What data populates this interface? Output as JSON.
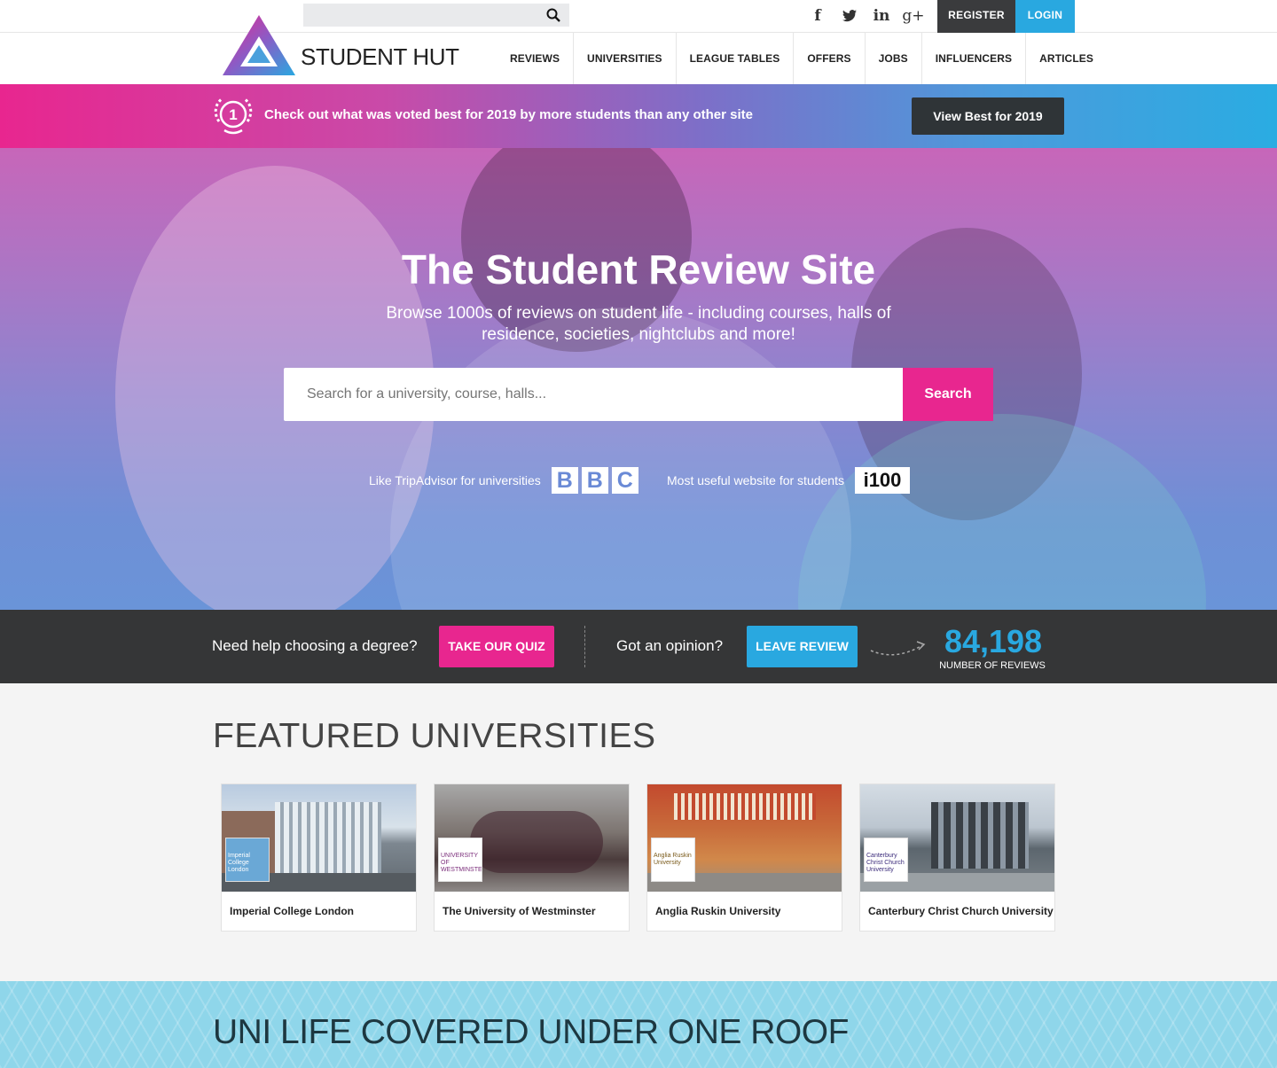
{
  "topbar": {
    "search_placeholder": "",
    "social": [
      {
        "icon": "facebook-icon",
        "glyph": "f"
      },
      {
        "icon": "twitter-icon",
        "glyph": "ᵯ"
      },
      {
        "icon": "linkedin-icon",
        "glyph": "in"
      },
      {
        "icon": "google-plus-icon",
        "glyph": "g+"
      }
    ],
    "register_label": "REGISTER",
    "login_label": "LOGIN"
  },
  "header": {
    "brand": "STUDENT HUT",
    "nav": [
      "REVIEWS",
      "UNIVERSITIES",
      "LEAGUE TABLES",
      "OFFERS",
      "JOBS",
      "INFLUENCERS",
      "ARTICLES"
    ]
  },
  "promo": {
    "badge_number": "1",
    "text": "Check out what was voted best for 2019 by more students than any other site",
    "button_label": "View Best for 2019"
  },
  "hero": {
    "title": "The Student Review Site",
    "subtitle": "Browse 1000s of reviews on student life - including courses, halls of residence, societies, nightclubs and more!",
    "search_placeholder": "Search for a university, course, halls...",
    "search_button": "Search",
    "press": [
      {
        "text": "Like TripAdvisor for universities",
        "logo": "BBC"
      },
      {
        "text": "Most useful website for students",
        "logo": "i100"
      }
    ]
  },
  "strip": {
    "degree_question": "Need help choosing a degree?",
    "quiz_label": "TAKE OUR QUIZ",
    "opinion_question": "Got an opinion?",
    "review_label": "LEAVE REVIEW",
    "review_count": "84,198",
    "review_count_label": "NUMBER OF REVIEWS"
  },
  "featured": {
    "heading": "FEATURED UNIVERSITIES",
    "universities": [
      {
        "name": "Imperial College London",
        "logo_text": "Imperial College London"
      },
      {
        "name": "The University of Westminster",
        "logo_text": "UNIVERSITY OF WESTMINSTER"
      },
      {
        "name": "Anglia Ruskin University",
        "logo_text": "Anglia Ruskin University"
      },
      {
        "name": "Canterbury Christ Church University",
        "logo_text": "Canterbury Christ Church University"
      }
    ]
  },
  "band": {
    "heading": "UNI LIFE COVERED UNDER ONE ROOF"
  },
  "colors": {
    "pink": "#e8268f",
    "blue": "#29a8e0",
    "dark": "#353637"
  }
}
